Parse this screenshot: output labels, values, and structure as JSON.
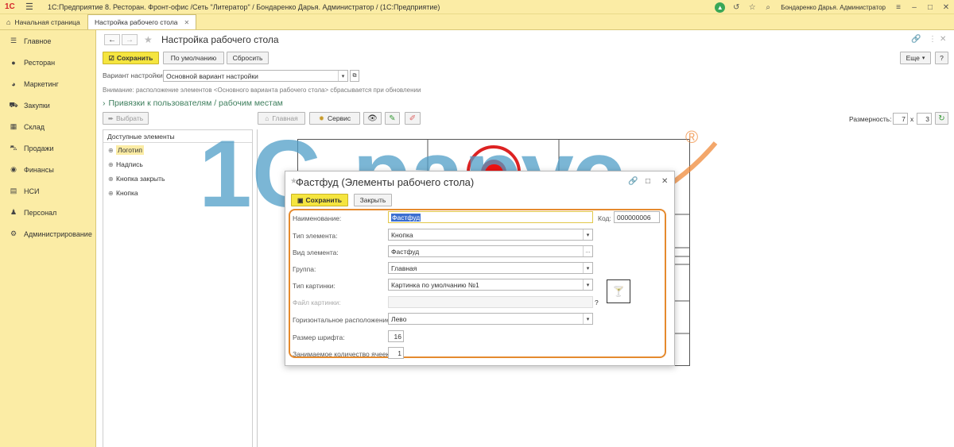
{
  "titlebar": {
    "logo": "1С",
    "title": "1С:Предприятие 8. Ресторан. Фронт-офис /Сеть \"Литератор\" / Бондаренко Дарья. Администратор /  (1С:Предприятие)",
    "user": "Бондаренко Дарья. Администратор"
  },
  "tabs": [
    {
      "label": "Начальная страница"
    },
    {
      "label": "Настройка рабочего стола"
    }
  ],
  "sidebar": {
    "items": [
      {
        "label": "Главное",
        "icon": "menu-icon"
      },
      {
        "label": "Ресторан",
        "icon": "person-icon"
      },
      {
        "label": "Маркетинг",
        "icon": "chart-icon"
      },
      {
        "label": "Закупки",
        "icon": "cart-icon"
      },
      {
        "label": "Склад",
        "icon": "grid-icon"
      },
      {
        "label": "Продажи",
        "icon": "basket-icon"
      },
      {
        "label": "Финансы",
        "icon": "coin-icon"
      },
      {
        "label": "НСИ",
        "icon": "book-icon"
      },
      {
        "label": "Персонал",
        "icon": "user-icon"
      },
      {
        "label": "Администрирование",
        "icon": "gear-icon"
      }
    ]
  },
  "page": {
    "title": "Настройка рабочего стола",
    "save": "Сохранить",
    "default": "По умолчанию",
    "reset": "Сбросить",
    "more": "Еще",
    "help": "?",
    "variant_label": "Вариант настройки:",
    "variant_value": "Основной вариант настройки",
    "warning": "Внимание: расположение элементов <Основного варианта рабочего стола> сбрасывается при обновлении",
    "bindings_link": "Привязки к пользователям / рабочим местам",
    "choose": "Выбрать",
    "home_btn": "Главная",
    "service_btn": "Сервис",
    "size_label": "Размерность:",
    "size_cols": "7",
    "size_x": "x",
    "size_rows": "3"
  },
  "available": {
    "header": "Доступные элементы",
    "items": [
      "Логотип",
      "Надпись",
      "Кнопка закрыть",
      "Кнопка"
    ]
  },
  "dialog": {
    "title": "Фастфуд (Элементы рабочего стола)",
    "save": "Сохранить",
    "close": "Закрыть",
    "fields": {
      "name_label": "Наименование:",
      "name_value": "Фастфуд",
      "code_label": "Код:",
      "code_value": "000000006",
      "type_label": "Тип элемента:",
      "type_value": "Кнопка",
      "kind_label": "Вид элемента:",
      "kind_value": "Фастфуд",
      "group_label": "Группа:",
      "group_value": "Главная",
      "pic_type_label": "Тип картинки:",
      "pic_type_value": "Картинка по умолчанию №1",
      "pic_file_label": "Файл картинки:",
      "pic_file_value": "",
      "help_q": "?",
      "halign_label": "Горизонтальное расположение:",
      "halign_value": "Лево",
      "font_label": "Размер шрифта:",
      "font_value": "16",
      "cells_label": "Занимаемое количество ячеек:",
      "cells_value": "1"
    }
  },
  "watermark": {
    "text": "1С-рарус",
    "registered": "®",
    "color_blue": "#4f9ec8",
    "color_orange": "#f08a3a"
  }
}
